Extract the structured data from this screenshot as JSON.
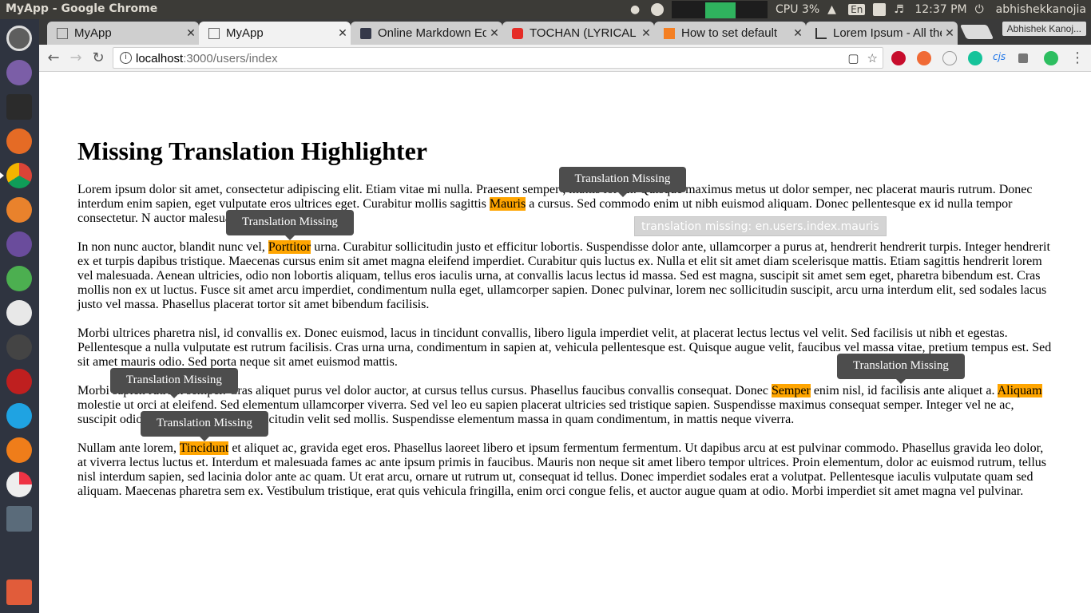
{
  "system": {
    "window_title": "MyApp - Google Chrome",
    "cpu": "CPU 3%",
    "keyboard": "En",
    "time": "12:37 PM",
    "user": "abhishekkanojia"
  },
  "browser": {
    "tabs": [
      {
        "label": "MyApp",
        "icon": "document-icon",
        "active": false
      },
      {
        "label": "MyApp",
        "icon": "document-icon",
        "active": true
      },
      {
        "label": "Online Markdown Editor",
        "icon": "dillinger-icon",
        "active": false
      },
      {
        "label": "TOCHAN (LYRICAL VIDEO)",
        "icon": "youtube-icon",
        "active": false
      },
      {
        "label": "How to set default",
        "icon": "stackoverflow-icon",
        "active": false
      },
      {
        "label": "Lorem Ipsum - All the",
        "icon": "lipsum-icon",
        "active": false
      }
    ],
    "profile_name": "Abhishek Kanoj...",
    "url_host": "localhost",
    "url_path": ":3000/users/index"
  },
  "page": {
    "heading": "Missing Translation Highlighter",
    "p1": {
      "a": "Lorem ipsum dolor sit amet, consectetur adipiscing elit. Etiam vitae mi nulla. Praesent semper ",
      "b": ", mattis lorem. Quisque maximus metus ut dolor semper, nec placerat mauris rutrum. Donec interdum enim sapien, eget vulputate eros ultrices eget. Curabitur mollis sagittis ",
      "highlight": "Mauris",
      "c": " a cursus. Sed commodo enim ut nibh euismod aliquam. Donec pellentesque ex id nulla tempor consectetur. N",
      "d": " auctor malesuada."
    },
    "p2": {
      "a": "In non nunc auctor, blandit nunc vel, ",
      "highlight": "Porttitor",
      "b": " urna. Curabitur sollicitudin justo et efficitur lobortis. Suspendisse dolor ante, ullamcorper a purus at, hendrerit hendrerit turpis. Integer hendrerit ex et turpis dapibus tristique. Maecenas cursus enim sit amet magna eleifend imperdiet. Curabitur quis luctus ex. Nulla et elit sit amet diam scelerisque mattis. Etiam sagittis hendrerit lorem vel malesuada. Aenean ultricies, odio non lobortis aliquam, tellus eros iaculis urna, at convallis lacus lectus id massa. Sed est magna, suscipit sit amet sem eget, pharetra bibendum est. Cras mollis non ex ut luctus. Fusce sit amet arcu imperdiet, condimentum nulla eget, ullamcorper sapien. Donec pulvinar, lorem nec sollicitudin suscipit, arcu urna interdum elit, sed sodales lacus justo vel massa. Phasellus placerat tortor sit amet bibendum facilisis."
    },
    "p3": {
      "text": "Morbi ultrices pharetra nisl, id convallis ex. Donec euismod, lacus in tincidunt convallis, libero ligula imperdiet velit, at placerat lectus lectus vel velit. Sed facilisis ut nibh et egestas. Pellentesque a nulla vulputate est rutrum facilisis. Cras urna urna, condimentum in sapien at, vehicula pellentesque est. Quisque augue velit, faucibus vel massa vitae, pretium tempus est. Sed sit amet mauris odio. Sed porta neque sit amet euismod mattis."
    },
    "p4": {
      "a": "Morbi",
      "b": "sapien rutrum semper. Cras aliquet purus vel dolor auctor, at cursus tellus cursus. Phasellus faucibus convallis consequat. Donec ",
      "highlight1": "Semper",
      "c": " enim nisl, id facilisis ante aliquet a. ",
      "highlight2": "Aliquam",
      "d": " molestie ut orci at eleifend. Sed elementum ullamcorper viverra. Sed vel leo eu sapien placerat ultricies sed tristique sapien. Suspendisse maximus consequat semper. Integer vel n",
      "e": "e ac, suscipit odio. Praesent venenatis sollicitudin velit sed mollis. Suspendisse elementum massa in quam condimentum, in mattis neque viverra."
    },
    "p5": {
      "a": "Nullam ante lorem, ",
      "highlight": "Tincidunt",
      "b": " et aliquet ac, gravida eget eros. Phasellus laoreet libero et ipsum fermentum fermentum. Ut dapibus arcu at est pulvinar commodo. Phasellus gravida leo dolor, at viverra lectus luctus et. Interdum et malesuada fames ac ante ipsum primis in faucibus. Mauris non neque sit amet libero tempor ultrices. Proin elementum, dolor ac euismod rutrum, tellus nisl interdum sapien, sed lacinia dolor ante ac quam. Ut erat arcu, ornare ut rutrum ut, consequat id tellus. Donec imperdiet sodales erat a volutpat. Pellentesque iaculis vulputate quam sed aliquam. Maecenas pharetra sem ex. Vestibulum tristique, erat quis vehicula fringilla, enim orci congue felis, et auctor augue quam at odio. Morbi imperdiet sit amet magna vel pulvinar."
    },
    "tooltip_label": "Translation Missing",
    "native_tooltip": "translation missing: en.users.index.mauris"
  }
}
